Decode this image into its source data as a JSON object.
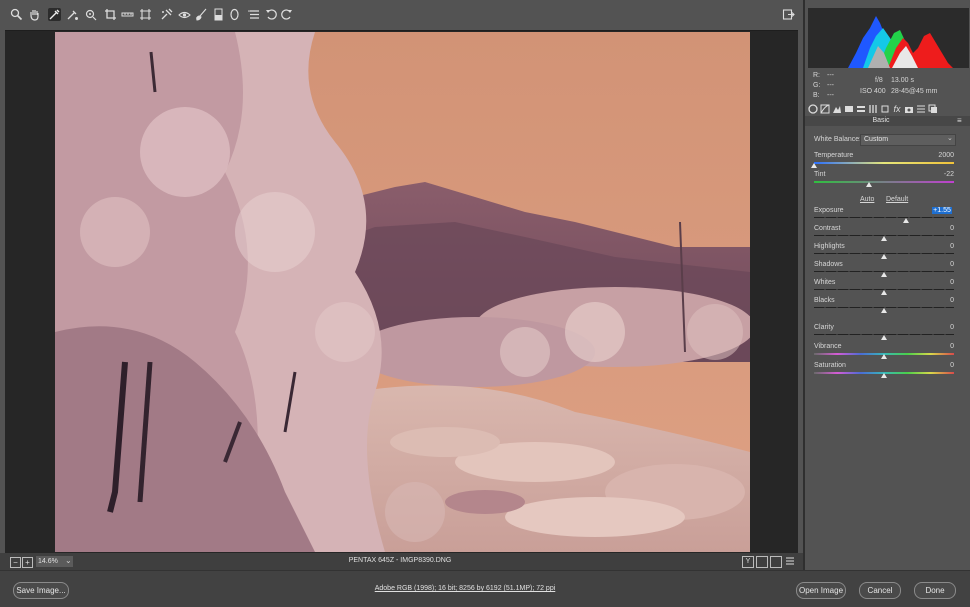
{
  "toolbar": {
    "tools": [
      "zoom-icon",
      "hand-icon",
      "white-balance-icon",
      "color-sampler-icon",
      "targeted-adjustment-icon",
      "crop-icon",
      "straighten-icon",
      "transform-icon",
      "spot-removal-icon",
      "red-eye-icon",
      "adjustment-brush-icon",
      "graduated-filter-icon",
      "radial-filter-icon",
      "preferences-icon",
      "rotate-left-icon",
      "rotate-right-icon"
    ]
  },
  "status": {
    "zoom": "14.6%",
    "camera_file": "PENTAX 645Z  -  IMGP8390.DNG"
  },
  "info": {
    "r_label": "R:",
    "r_value": "---",
    "g_label": "G:",
    "g_value": "---",
    "b_label": "B:",
    "b_value": "---",
    "aperture": "f/8",
    "shutter": "13.00 s",
    "iso": "ISO 400",
    "lens": "28-45@45 mm"
  },
  "panel": {
    "section_title": "Basic",
    "white_balance_label": "White Balance:",
    "white_balance_value": "Custom",
    "auto_label": "Auto",
    "default_label": "Default",
    "sliders": [
      {
        "label": "Temperature",
        "value": "2000",
        "level": 0.0
      },
      {
        "label": "Tint",
        "value": "-22",
        "level": 0.39
      },
      {
        "label": "Exposure",
        "value": "+1.55",
        "level": 0.66
      },
      {
        "label": "Contrast",
        "value": "0",
        "level": 0.5
      },
      {
        "label": "Highlights",
        "value": "0",
        "level": 0.5
      },
      {
        "label": "Shadows",
        "value": "0",
        "level": 0.5
      },
      {
        "label": "Whites",
        "value": "0",
        "level": 0.5
      },
      {
        "label": "Blacks",
        "value": "0",
        "level": 0.5
      },
      {
        "label": "Clarity",
        "value": "0",
        "level": 0.5
      },
      {
        "label": "Vibrance",
        "value": "0",
        "level": 0.5
      },
      {
        "label": "Saturation",
        "value": "0",
        "level": 0.5
      }
    ]
  },
  "bottom": {
    "save_label": "Save Image...",
    "workflow_link": "Adobe RGB (1998); 16 bit; 8256 by 6192 (51.1MP); 72 ppi",
    "open_label": "Open Image",
    "cancel_label": "Cancel",
    "done_label": "Done"
  },
  "colors": {
    "sky": "#d89a7c",
    "foliage": "#c9a0a6",
    "highlight": "#1e6fd1"
  }
}
